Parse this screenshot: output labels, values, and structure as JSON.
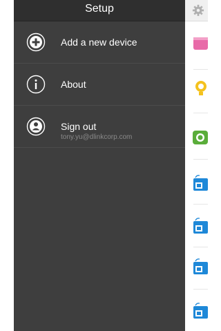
{
  "drawer": {
    "title": "Setup",
    "items": [
      {
        "label": "Add a new device",
        "icon": "plus-circle-icon"
      },
      {
        "label": "About",
        "icon": "info-circle-icon"
      },
      {
        "label": "Sign out",
        "icon": "user-circle-icon",
        "sub": "tony.yu@dlinkcorp.com"
      }
    ]
  },
  "right_panel": {
    "icons": [
      "gear-icon",
      "pink-device-icon",
      "yellow-sensor-icon",
      "green-device-icon",
      "blue-camera-icon",
      "blue-camera-icon",
      "blue-camera-icon",
      "blue-camera-icon"
    ]
  }
}
